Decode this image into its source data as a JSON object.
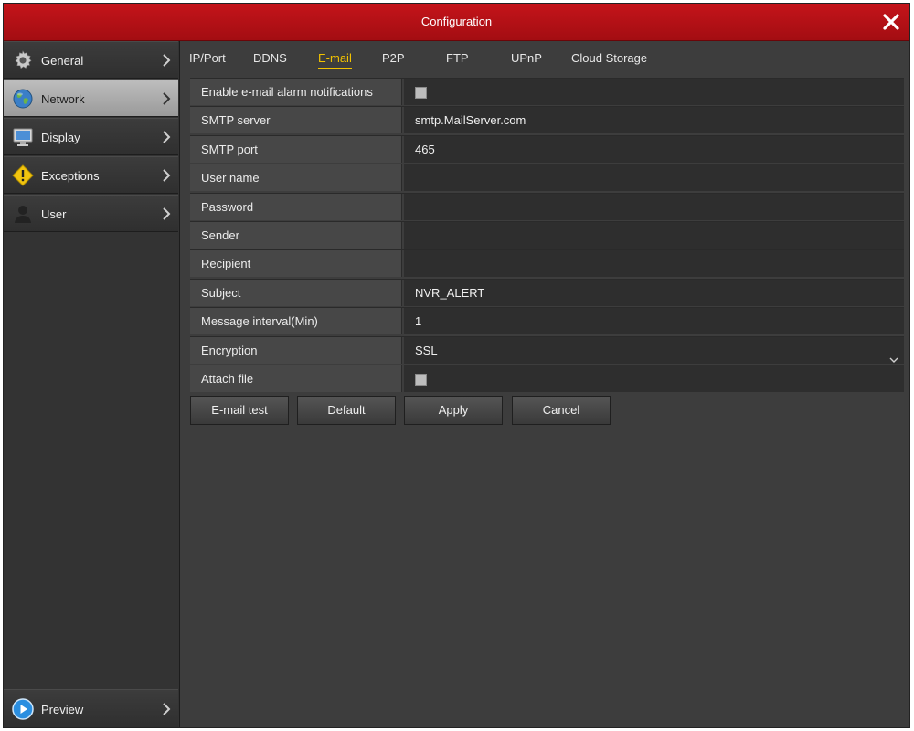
{
  "window": {
    "title": "Configuration"
  },
  "sidebar": {
    "items": [
      {
        "label": "General",
        "icon": "gear-icon",
        "active": false
      },
      {
        "label": "Network",
        "icon": "globe-icon",
        "active": true
      },
      {
        "label": "Display",
        "icon": "monitor-icon",
        "active": false
      },
      {
        "label": "Exceptions",
        "icon": "warning-icon",
        "active": false
      },
      {
        "label": "User",
        "icon": "user-icon",
        "active": false
      }
    ],
    "preview": {
      "label": "Preview",
      "icon": "play-icon"
    }
  },
  "tabs": [
    {
      "label": "IP/Port"
    },
    {
      "label": "DDNS"
    },
    {
      "label": "E-mail",
      "active": true
    },
    {
      "label": "P2P"
    },
    {
      "label": "FTP"
    },
    {
      "label": "UPnP"
    },
    {
      "label": "Cloud Storage"
    }
  ],
  "form": {
    "enable_label": "Enable e-mail alarm notifications",
    "enable_checked": false,
    "smtp_server_label": "SMTP server",
    "smtp_server_value": "smtp.MailServer.com",
    "smtp_port_label": "SMTP port",
    "smtp_port_value": "465",
    "username_label": "User name",
    "username_value": "",
    "password_label": "Password",
    "password_value": "",
    "sender_label": "Sender",
    "sender_value": "",
    "recipient_label": "Recipient",
    "recipient_value": "",
    "subject_label": "Subject",
    "subject_value": "NVR_ALERT",
    "interval_label": "Message interval(Min)",
    "interval_value": "1",
    "encryption_label": "Encryption",
    "encryption_value": "SSL",
    "attach_label": "Attach file",
    "attach_checked": false
  },
  "buttons": {
    "email_test": "E-mail test",
    "default": "Default",
    "apply": "Apply",
    "cancel": "Cancel"
  },
  "colors": {
    "titlebar": "#b3111a",
    "active_tab": "#f2c200",
    "background": "#3d3d3d"
  }
}
